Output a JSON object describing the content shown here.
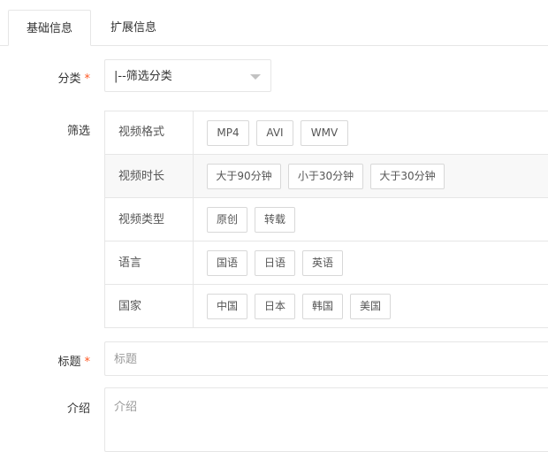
{
  "tabs": {
    "basic": "基础信息",
    "extended": "扩展信息"
  },
  "form": {
    "category_label": "分类",
    "category_value": "|--筛选分类",
    "filter_label": "筛选",
    "title_label": "标题",
    "title_placeholder": "标题",
    "intro_label": "介绍",
    "intro_placeholder": "介绍",
    "required_mark": "*"
  },
  "filters": [
    {
      "name": "视频格式",
      "options": [
        "MP4",
        "AVI",
        "WMV"
      ]
    },
    {
      "name": "视频时长",
      "options": [
        "大于90分钟",
        "小于30分钟",
        "大于30分钟"
      ]
    },
    {
      "name": "视频类型",
      "options": [
        "原创",
        "转载"
      ]
    },
    {
      "name": "语言",
      "options": [
        "国语",
        "日语",
        "英语"
      ]
    },
    {
      "name": "国家",
      "options": [
        "中国",
        "日本",
        "韩国",
        "美国"
      ]
    }
  ],
  "colors": {
    "required": "#ff5722",
    "border": "#e6e6e6",
    "alt_row": "#f8f8f8"
  }
}
